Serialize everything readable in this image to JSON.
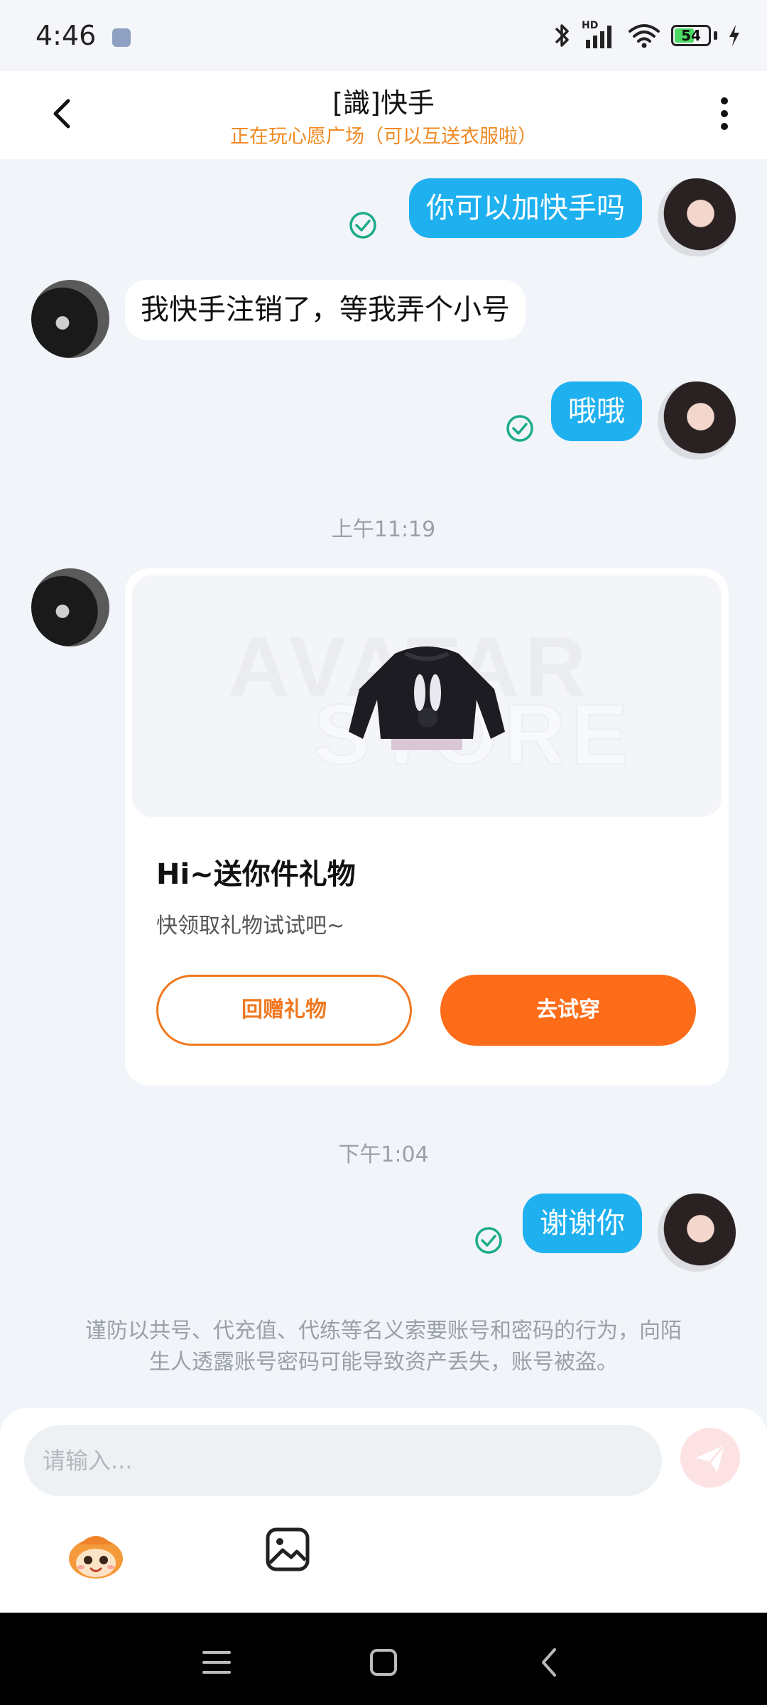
{
  "status_bar": {
    "time": "4:46",
    "network": "HD",
    "battery": "54"
  },
  "header": {
    "title": "[識]快手",
    "subtitle": "正在玩心愿广场（可以互送衣服啦）"
  },
  "messages": [
    {
      "direction": "outgoing",
      "text": "你可以加快手吗",
      "read": true
    },
    {
      "direction": "incoming",
      "text": "我快手注销了，等我弄个小号"
    },
    {
      "direction": "outgoing",
      "text": "哦哦",
      "read": true
    }
  ],
  "timestamps": {
    "first": "上午11:19",
    "second": "下午1:04"
  },
  "gift_card": {
    "watermark_line1": "AVATAR",
    "watermark_line2": "STORE",
    "title": "Hi~送你件礼物",
    "description": "快领取礼物试试吧~",
    "return_gift_label": "回赠礼物",
    "try_on_label": "去试穿"
  },
  "last_message": {
    "direction": "outgoing",
    "text": "谢谢你",
    "read": true
  },
  "warning": {
    "line1": "谨防以共号、代充值、代练等名义索要账号和密码的行为，向陌",
    "line2": "生人透露账号密码可能导致资产丢失，账号被盗。"
  },
  "composer": {
    "placeholder": "请输入..."
  },
  "colors": {
    "outgoing_bubble": "#1fb0f0",
    "accent_orange": "#fd6d19",
    "subtitle_orange": "#f08a24",
    "read_check": "#1aab8a"
  },
  "icons": {
    "back": "chevron-left-icon",
    "more": "more-vertical-icon",
    "read": "check-circle-icon",
    "send": "send-icon",
    "mascot": "mascot-icon",
    "image": "image-icon",
    "nav_menu": "menu-icon",
    "nav_home": "home-square-icon",
    "nav_back": "nav-back-icon"
  }
}
